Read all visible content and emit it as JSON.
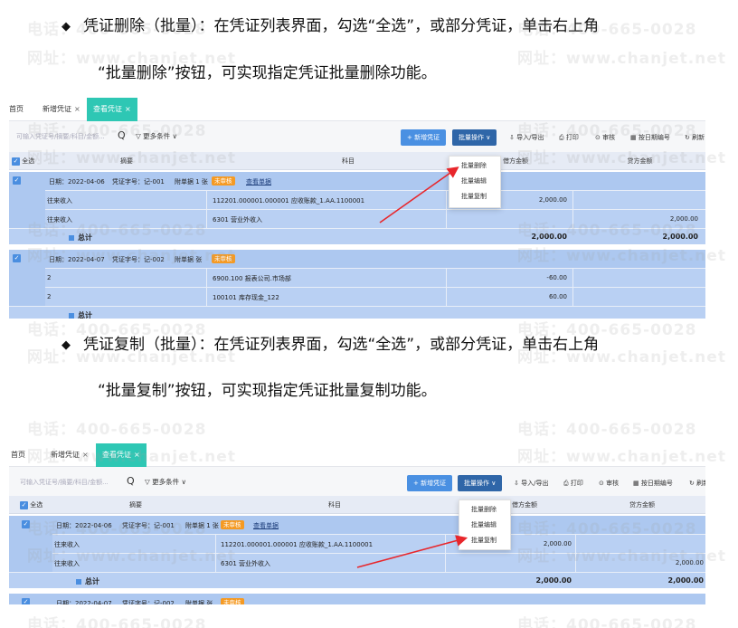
{
  "paragraphs": [
    {
      "bullet": "◆",
      "line1": "凭证删除（批量）：在凭证列表界面，勾选“全选”，或部分凭证，单击右上角",
      "line2": "“批量删除”按钮，可实现指定凭证批量删除功能。"
    },
    {
      "bullet": "◆",
      "line1": "凭证复制（批量）：在凭证列表界面，勾选“全选”，或部分凭证，单击右上角",
      "line2": "“批量复制”按钮，可实现指定凭证批量复制功能。"
    }
  ],
  "watermark": {
    "phone": "电话：400-665-0028",
    "site": "网址：www.chanjet.net"
  },
  "screenshot": {
    "tabs": [
      "首页",
      "新增凭证",
      "查看凭证"
    ],
    "tab_close": "×",
    "search_placeholder": "可输入凭证号/摘要/科目/金额...",
    "search_icon": "Q",
    "more_filter": "▽ 更多条件 ∨",
    "btn_new": "+ 新增凭证",
    "btn_batch": "批量操作 ∨",
    "tools": [
      "⇩ 导入/导出",
      "⎙ 打印",
      "⊙ 审核",
      "▦ 按日期编号",
      "↻ 刷新"
    ],
    "columns": {
      "select_all": "全选",
      "summary": "摘要",
      "account": "科目",
      "debit": "借方金额",
      "credit": "贷方金额"
    },
    "check_mark": "✓",
    "dropdown_items": [
      "批量删除",
      "批量编辑",
      "批量复制"
    ],
    "voucher1": {
      "date": "日期：2022-04-06",
      "number": "凭证字号：记-001",
      "attach": "附单据 1 张",
      "status": "未审核",
      "view": "查看单据",
      "rows": [
        {
          "summary": "往来收入",
          "account": "112201.000001.000001 应收账款_1.AA.1100001",
          "debit": "2,000.00",
          "credit": ""
        },
        {
          "summary": "往来收入",
          "account": "6301 营业外收入",
          "debit": "",
          "credit": "2,000.00"
        }
      ],
      "total_label": "总计",
      "total_debit": "2,000.00",
      "total_credit": "2,000.00"
    },
    "voucher2": {
      "date": "日期：2022-04-07",
      "number": "凭证字号：记-002",
      "attach": "附单据",
      "attach_unit": "张",
      "status": "未审核",
      "rows": [
        {
          "summary": "2",
          "account": "6900.100 报表公司.市场部",
          "debit": "-60.00",
          "credit": ""
        },
        {
          "summary": "2",
          "account": "100101 库存现金_122",
          "debit": "60.00",
          "credit": ""
        }
      ],
      "total_label": "总计"
    }
  }
}
